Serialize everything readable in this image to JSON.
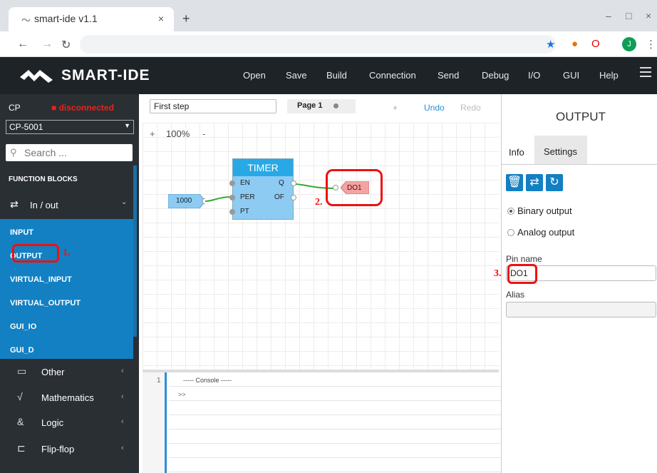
{
  "browser": {
    "tab_title": "smart-ide v1.1",
    "tab_close": "×",
    "new_tab": "+",
    "avatar": "J"
  },
  "app": {
    "logo": "SMART-IDE",
    "menu": [
      "Open",
      "Save",
      "Build",
      "Connection",
      "Send",
      "Debug",
      "I/O",
      "GUI",
      "Help"
    ]
  },
  "sidebar": {
    "cp_label": "CP",
    "status": "■ disconnected",
    "device": "CP-5001",
    "search_placeholder": "Search ...",
    "section": "FUNCTION BLOCKS",
    "group": {
      "label": "In / out"
    },
    "sub_items": [
      "INPUT",
      "OUTPUT",
      "VIRTUAL_INPUT",
      "VIRTUAL_OUTPUT",
      "GUI_IO",
      "GUI_D"
    ],
    "categories": [
      {
        "label": "Other",
        "icon": "chat-icon"
      },
      {
        "label": "Mathematics",
        "icon": "sqrt-icon"
      },
      {
        "label": "Logic",
        "icon": "ampersand-icon"
      },
      {
        "label": "Flip-flop",
        "icon": "flipflop-icon"
      }
    ]
  },
  "canvas": {
    "step_name": "First step",
    "page_tab": "Page 1",
    "plus": "+",
    "undo": "Undo",
    "redo": "Redo",
    "zoom_plus": "+",
    "zoom": "100%",
    "zoom_minus": "-",
    "timer": {
      "title": "TIMER",
      "inputs": [
        "EN",
        "PER",
        "PT"
      ],
      "outputs": [
        "Q",
        "OF"
      ]
    },
    "constant": "1000",
    "output_block": "DO1"
  },
  "annotations": {
    "mark1": "1.",
    "mark2": "2.",
    "mark3": "3."
  },
  "console": {
    "line_no": "1",
    "title": "----- Console -----",
    "prompt": ">>"
  },
  "panel": {
    "title": "OUTPUT",
    "tab_info": "Info",
    "tab_settings": "Settings",
    "radio_binary": "Binary output",
    "radio_analog": "Analog output",
    "pin_label": "Pin name",
    "pin_value": "DO1",
    "alias_label": "Alias",
    "alias_value": ""
  },
  "colors": {
    "accent": "#1380c3",
    "status_red": "#e8231a",
    "highlight": "#e11111",
    "timer_head": "#29a8e6"
  }
}
